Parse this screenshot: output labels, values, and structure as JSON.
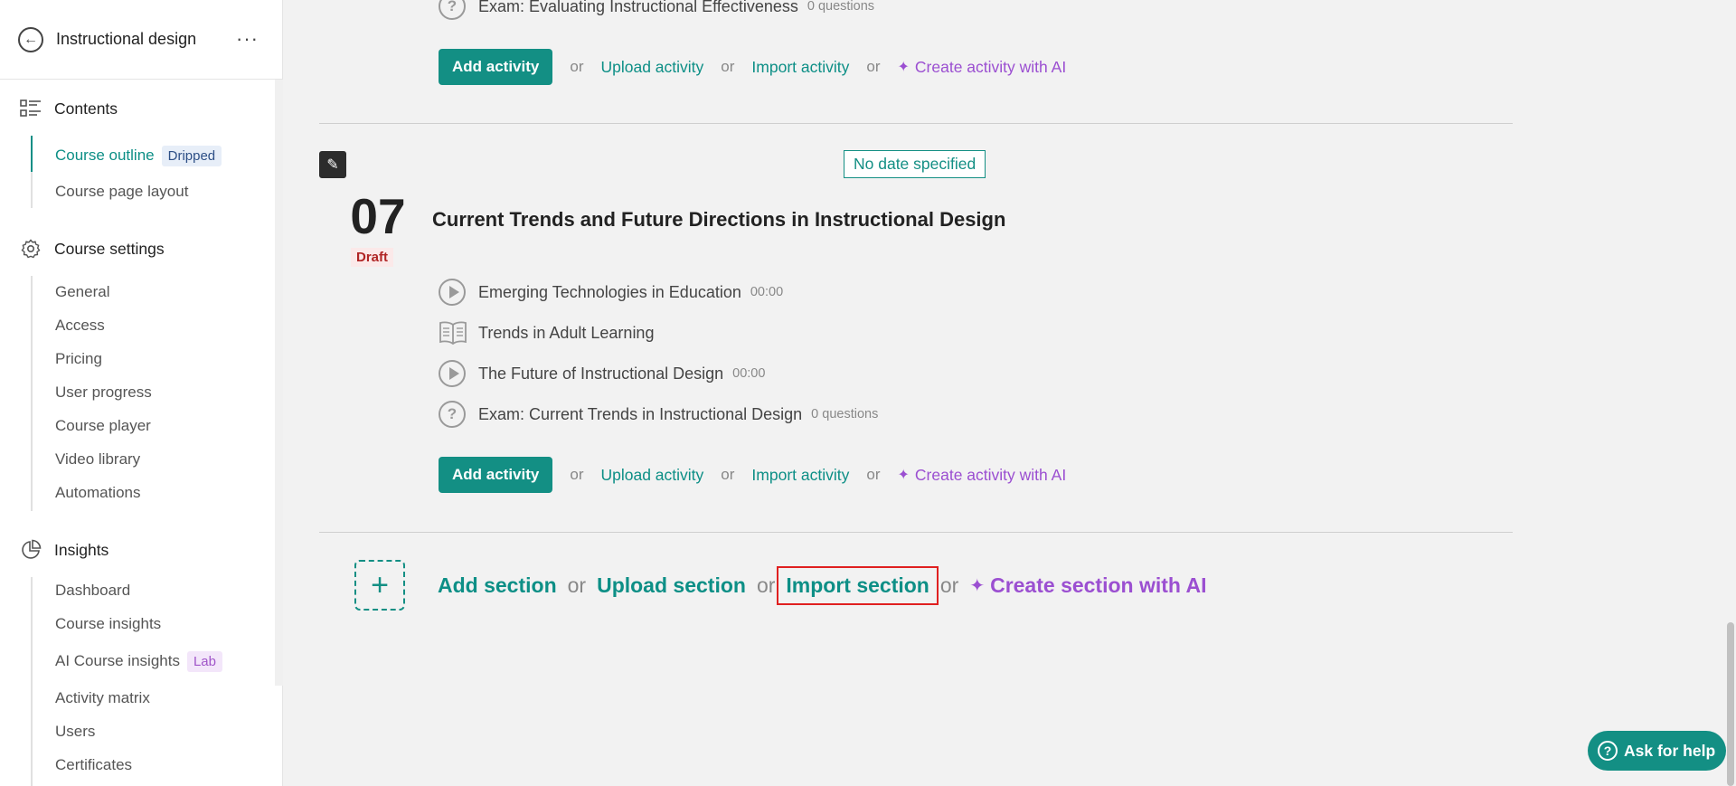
{
  "sidebar": {
    "title": "Instructional design",
    "groups": {
      "contents": {
        "label": "Contents",
        "items": [
          {
            "label": "Course outline",
            "badge": "Dripped"
          },
          {
            "label": "Course page layout"
          }
        ]
      },
      "settings": {
        "label": "Course settings",
        "items": [
          "General",
          "Access",
          "Pricing",
          "User progress",
          "Course player",
          "Video library",
          "Automations"
        ]
      },
      "insights": {
        "label": "Insights",
        "items": [
          "Dashboard",
          "Course insights",
          "AI Course insights",
          "Activity matrix",
          "Users",
          "Certificates"
        ],
        "lab_badge": "Lab"
      }
    }
  },
  "prev_section": {
    "exam": {
      "title": "Exam: Evaluating Instructional Effectiveness",
      "meta": "0 questions"
    }
  },
  "actions": {
    "add": "Add activity",
    "or": "or",
    "upload": "Upload activity",
    "import": "Import activity",
    "ai": "Create activity with AI"
  },
  "section": {
    "date": "No date specified",
    "number": "07",
    "status": "Draft",
    "title": "Current Trends and Future Directions in Instructional Design",
    "activities": [
      {
        "type": "video",
        "icon": "play-icon",
        "title": "Emerging Technologies in Education",
        "meta": "00:00"
      },
      {
        "type": "reading",
        "icon": "book-icon",
        "title": "Trends in Adult Learning",
        "meta": ""
      },
      {
        "type": "video",
        "icon": "play-icon",
        "title": "The Future of Instructional Design",
        "meta": "00:00"
      },
      {
        "type": "exam",
        "icon": "question-icon",
        "title": "Exam: Current Trends in Instructional Design",
        "meta": "0 questions"
      }
    ]
  },
  "add_section": {
    "add": "Add section",
    "or": "or",
    "upload": "Upload section",
    "import": "Import section",
    "ai": "Create section with AI"
  },
  "help": {
    "label": "Ask for help"
  },
  "colors": {
    "accent": "#138f84",
    "ai": "#9b4fd1",
    "draft": "#b02424",
    "highlight": "#e02020"
  }
}
